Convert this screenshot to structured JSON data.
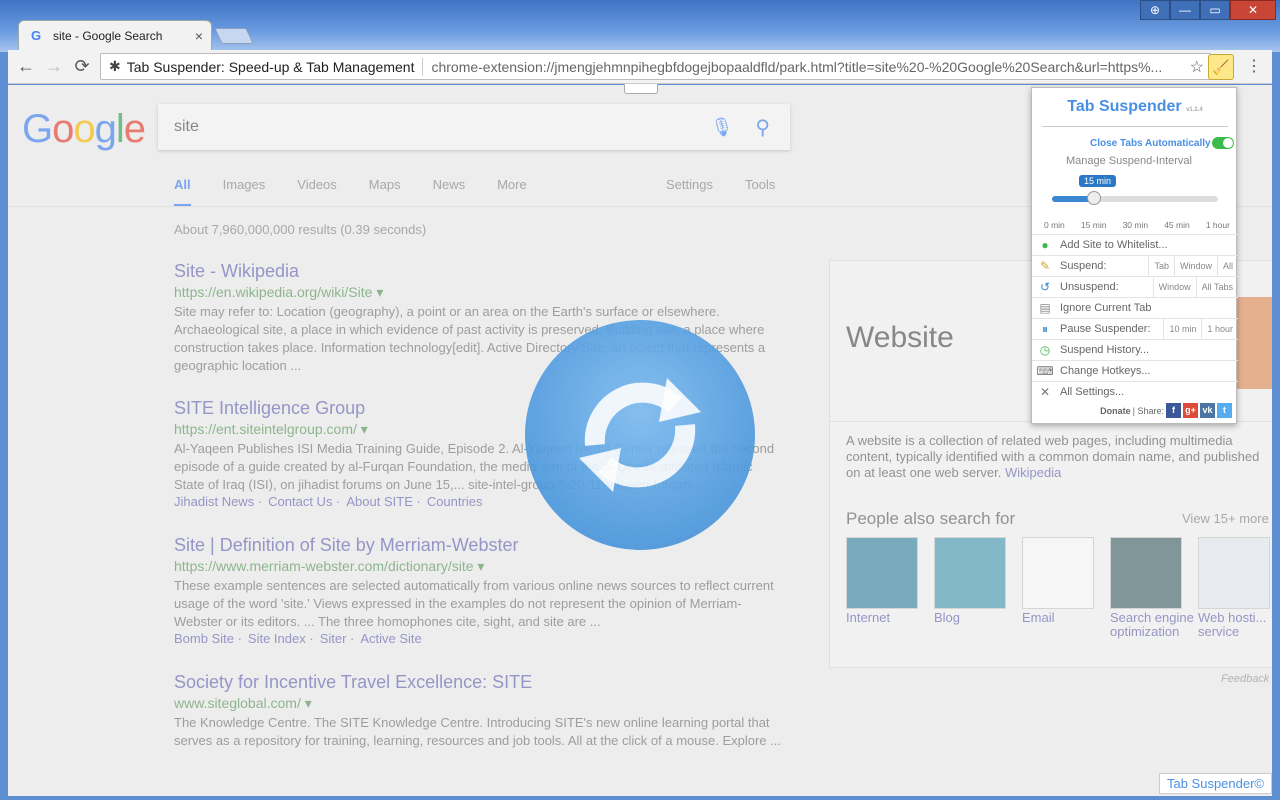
{
  "browser": {
    "tab_title": "site - Google Search",
    "tab_close": "×",
    "back": "←",
    "forward": "→",
    "reload": "⟳",
    "omnibox": {
      "ext_name": "Tab Suspender: Speed-up & Tab Management",
      "url": "chrome-extension://jmengjehmnpihegbfdogejbopaaldfld/park.html?title=site%20-%20Google%20Search&url=https%..."
    },
    "star": "☆",
    "menu": "⋮",
    "window_controls": {
      "restore": "▭",
      "minimize": "—",
      "close": "✕"
    }
  },
  "google": {
    "logo_letters": [
      {
        "t": "G",
        "c": "#4285f4"
      },
      {
        "t": "o",
        "c": "#ea4335"
      },
      {
        "t": "o",
        "c": "#fbbc05"
      },
      {
        "t": "g",
        "c": "#4285f4"
      },
      {
        "t": "l",
        "c": "#34a853"
      },
      {
        "t": "e",
        "c": "#ea4335"
      }
    ],
    "query": "site",
    "nav": [
      "All",
      "Images",
      "Videos",
      "Maps",
      "News",
      "More"
    ],
    "nav_right": [
      "Settings",
      "Tools"
    ],
    "stats": "About 7,960,000,000 results (0.39 seconds)",
    "results": [
      {
        "title": "Site - Wikipedia",
        "url": "https://en.wikipedia.org/wiki/Site ▾",
        "snippet": "Site may refer to: Location (geography), a point or an area on the Earth's surface or elsewhere. Archaeological site, a place in which evidence of past activity is preserved. Building site, a place where construction takes place. Information technology[edit]. Active Directory Site, an object that represents a geographic location ...",
        "links": []
      },
      {
        "title": "SITE Intelligence Group",
        "url": "https://ent.siteintelgroup.com/ ▾",
        "snippet": "Al-Yaqeen Publishes ISI Media Training Guide, Episode 2. Al-Yaqeen Media Center released the second episode of a guide created by al-Furqan Foundation, the media arm of the al-Qaeda-affiliated Islamic State of Iraq (ISI), on jihadist forums on June 15,... site-intel-group-5-20-11-yaqeen-furqan-...",
        "links": [
          "Jihadist News ·",
          "Contact Us ·",
          "About SITE ·",
          "Countries"
        ]
      },
      {
        "title": "Site | Definition of Site by Merriam-Webster",
        "url": "https://www.merriam-webster.com/dictionary/site ▾",
        "snippet": "These example sentences are selected automatically from various online news sources to reflect current usage of the word 'site.' Views expressed in the examples do not represent the opinion of Merriam-Webster or its editors. ... The three homophones cite, sight, and site are ...",
        "links": [
          "Bomb Site ·",
          "Site Index ·",
          "Siter ·",
          "Active Site"
        ]
      },
      {
        "title": "Society for Incentive Travel Excellence: SITE",
        "url": "www.siteglobal.com/ ▾",
        "snippet": "The Knowledge Centre. The SITE Knowledge Centre. Introducing SITE's new online learning portal that serves as a repository for training, learning, resources and job tools. All at the click of a mouse. Explore ...",
        "links": []
      }
    ],
    "knowledge_panel": {
      "title": "Website",
      "description": "A website is a collection of related web pages, including multimedia content, typically identified with a common domain name, and published on at least one web server.",
      "source": "Wikipedia",
      "people_also": "People also search for",
      "view_more": "View 15+ more",
      "tiles": [
        {
          "label": "Internet",
          "color": "#3f8aa8"
        },
        {
          "label": "Blog",
          "color": "#4ea0b8"
        },
        {
          "label": "Email",
          "color": "#ffffff"
        },
        {
          "label": "Search engine optimization",
          "color": "#4a6c70"
        },
        {
          "label": "Web hosti... service",
          "color": "#e8eef4"
        }
      ]
    },
    "feedback": "Feedback"
  },
  "popup": {
    "title": "Tab Suspender",
    "version": "v1.2.4",
    "close_tabs_auto": "Close Tabs Automatically",
    "manage_interval": "Manage Suspend-Interval",
    "interval_value": "15 min",
    "interval_fraction": 0.25,
    "ticks": [
      "0 min",
      "15 min",
      "30 min",
      "45 min",
      "1 hour"
    ],
    "rows": [
      {
        "label": "Add Site to Whitelist...",
        "icon": "●",
        "icon_color": "#3cbb4a",
        "opts": []
      },
      {
        "label": "Suspend:",
        "icon": "✎",
        "icon_color": "#c9a836",
        "opts": [
          "Tab",
          "Window",
          "All"
        ]
      },
      {
        "label": "Unsuspend:",
        "icon": "↺",
        "icon_color": "#3a86d0",
        "opts": [
          "Window",
          "All Tabs"
        ]
      },
      {
        "label": "Ignore Current Tab",
        "icon": "▤",
        "icon_color": "#888888",
        "opts": []
      },
      {
        "label": "Pause Suspender:",
        "icon": "⏸",
        "icon_color": "#3a86d0",
        "opts": [
          "10 min",
          "1 hour"
        ]
      },
      {
        "label": "Suspend History...",
        "icon": "◷",
        "icon_color": "#3cbb4a",
        "opts": []
      },
      {
        "label": "Change Hotkeys...",
        "icon": "⌨",
        "icon_color": "#777777",
        "opts": []
      },
      {
        "label": "All Settings...",
        "icon": "✕",
        "icon_color": "#777777",
        "opts": []
      }
    ],
    "donate": "Donate",
    "share": "| Share:",
    "share_icons": [
      {
        "t": "f",
        "c": "#3b5998"
      },
      {
        "t": "g+",
        "c": "#dd4b39"
      },
      {
        "t": "vk",
        "c": "#4c75a3"
      },
      {
        "t": "t",
        "c": "#55acee"
      }
    ]
  },
  "brand_badge": "Tab Suspender©"
}
